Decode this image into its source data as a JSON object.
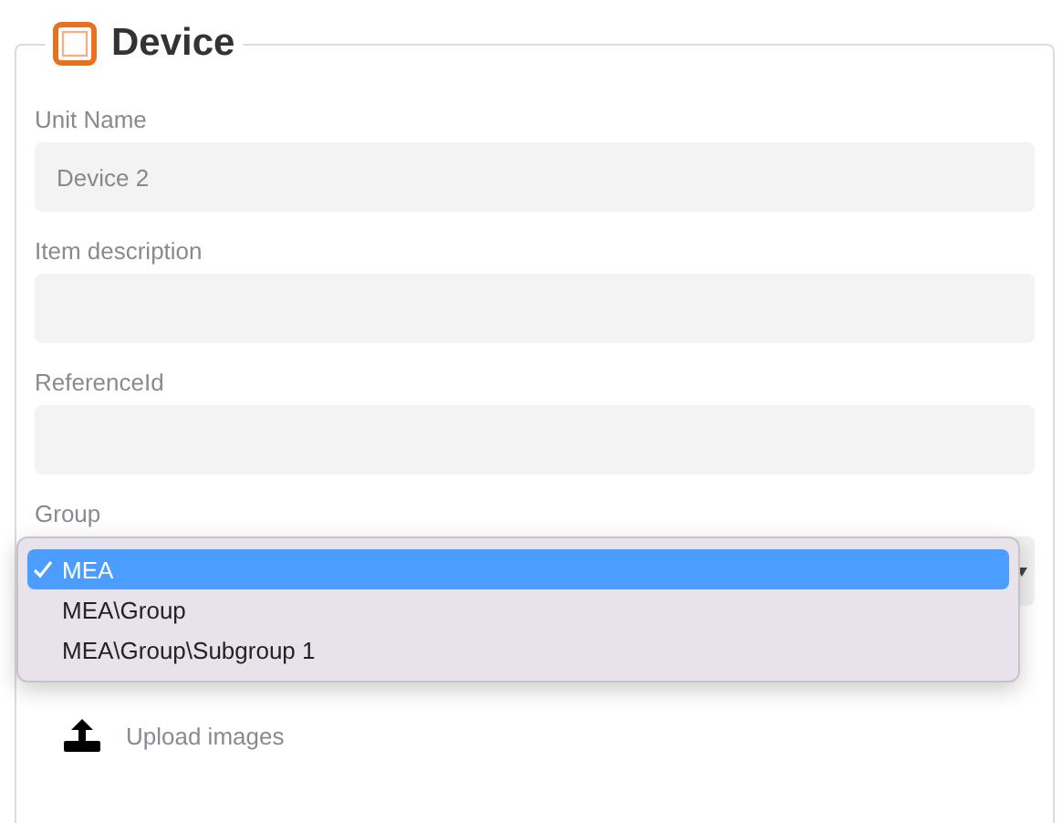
{
  "section": {
    "title": "Device"
  },
  "fields": [
    {
      "label": "Unit Name",
      "value": "Device 2"
    },
    {
      "label": "Item description"
    },
    {
      "label": "ReferenceId"
    }
  ],
  "group": {
    "label": "Group",
    "options": [
      {
        "label": "MEA",
        "selected": true
      },
      {
        "label": "MEA\\Group",
        "selected": false
      },
      {
        "label": "MEA\\Group\\Subgroup 1",
        "selected": false
      }
    ]
  },
  "upload": {
    "label": "Upload images"
  }
}
